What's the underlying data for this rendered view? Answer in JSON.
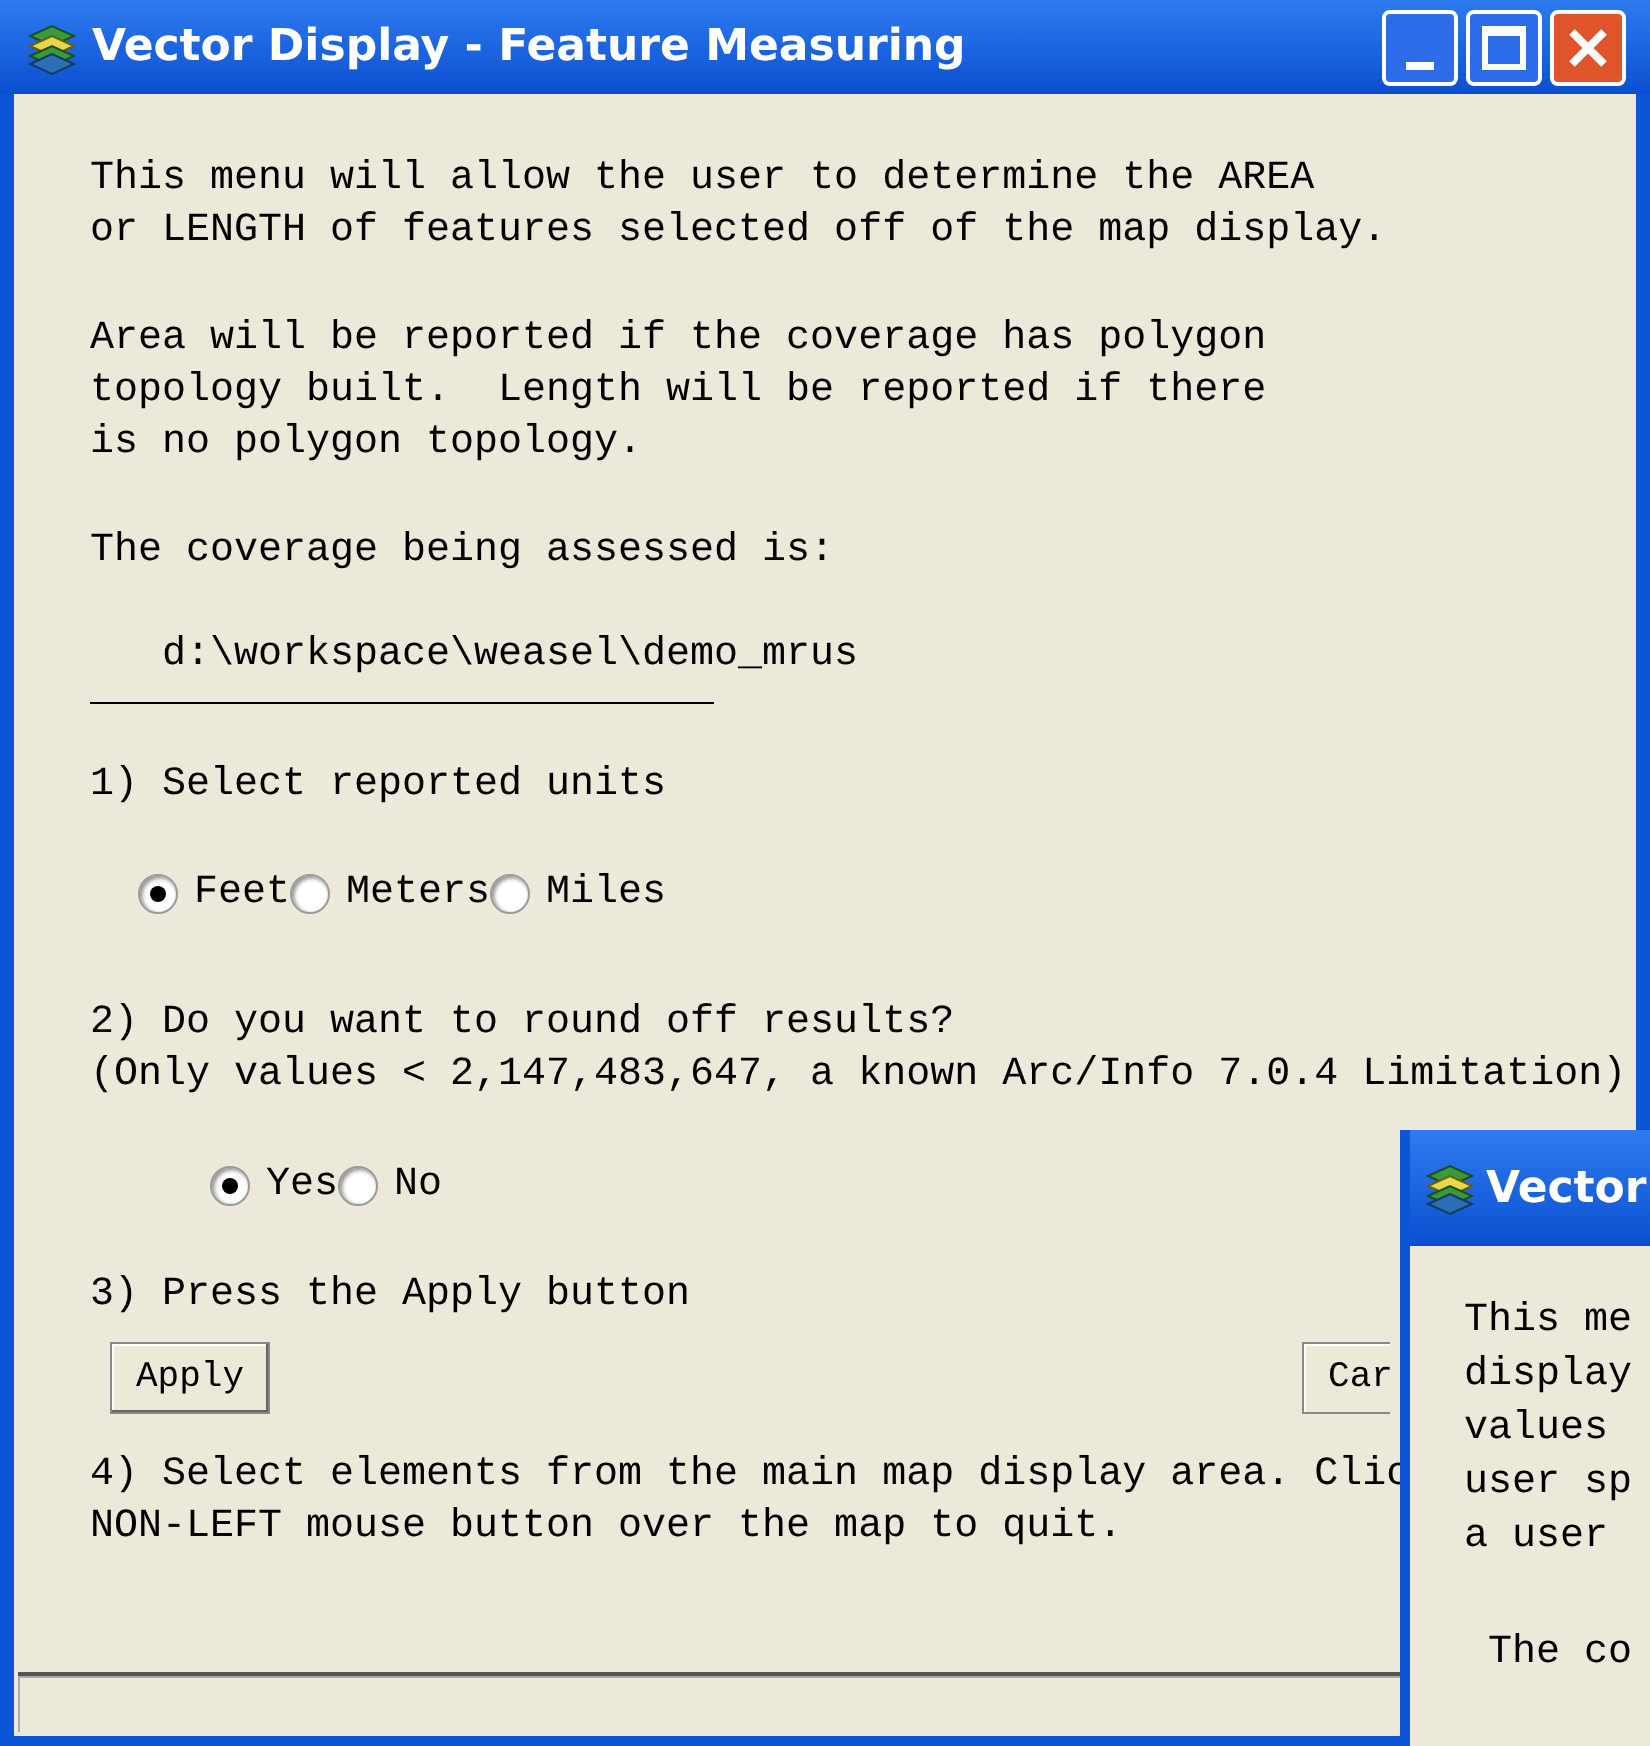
{
  "window": {
    "title": "Vector Display - Feature Measuring"
  },
  "intro": [
    [
      "This menu will allow the user to determine the AREA",
      "or LENGTH of features selected off of the map display."
    ],
    [
      "Area will be reported if the coverage has polygon",
      "topology built.  Length will be reported if there",
      "is no polygon topology."
    ],
    [
      "The coverage being assessed is:"
    ]
  ],
  "coverage_path": "d:\\workspace\\weasel\\demo_mrus",
  "units": {
    "label": "1) Select reported units",
    "options": [
      {
        "label": "Feet",
        "selected": true
      },
      {
        "label": "Meters",
        "selected": false
      },
      {
        "label": "Miles",
        "selected": false
      }
    ]
  },
  "rounding": {
    "label": [
      "2) Do you want to round off results?",
      "(Only values < 2,147,483,647, a known Arc/Info 7.0.4 Limitation)"
    ],
    "options": [
      {
        "label": "Yes",
        "selected": true
      },
      {
        "label": "No",
        "selected": false
      }
    ]
  },
  "apply_step": "3) Press the Apply button",
  "buttons": [
    "Apply",
    "Car"
  ],
  "select_step": [
    "4) Select elements from the main map display area. Clic",
    "NON-LEFT mouse button over the map to quit."
  ],
  "second_window": {
    "title": "Vector",
    "lines": [
      "This me",
      "display",
      "values",
      "user sp",
      "a user"
    ],
    "last_line": "The co"
  }
}
